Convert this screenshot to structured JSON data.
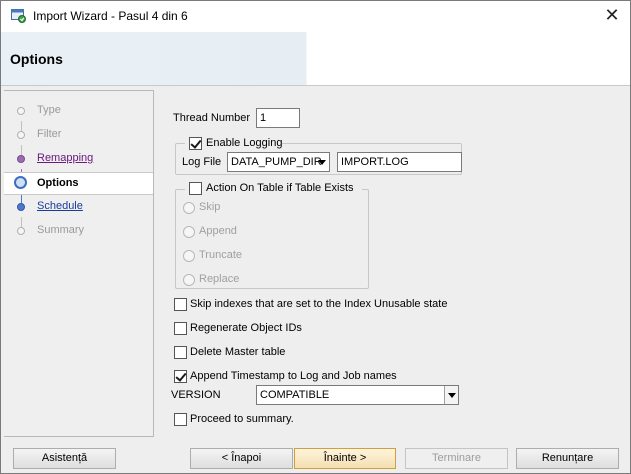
{
  "window": {
    "title": "Import Wizard - Pasul 4 din 6",
    "close_glyph": "✕"
  },
  "header": {
    "title": "Options"
  },
  "nav": {
    "items": [
      {
        "label": "Type",
        "state": "disabled"
      },
      {
        "label": "Filter",
        "state": "disabled"
      },
      {
        "label": "Remapping",
        "state": "visited"
      },
      {
        "label": "Options",
        "state": "active"
      },
      {
        "label": "Schedule",
        "state": "link"
      },
      {
        "label": "Summary",
        "state": "disabled"
      }
    ]
  },
  "options": {
    "thread_number_label": "Thread Number",
    "thread_number_value": "1",
    "enable_logging_label": "Enable Logging",
    "enable_logging_checked": true,
    "log_file_label": "Log File",
    "log_dir_value": "DATA_PUMP_DIR",
    "log_file_value": "IMPORT.LOG",
    "action_on_table_label": "Action On Table if Table Exists",
    "action_on_table_checked": false,
    "action_choices": [
      "Skip",
      "Append",
      "Truncate",
      "Replace"
    ],
    "skip_indexes_label": "Skip indexes that are set to the Index Unusable state",
    "skip_indexes_checked": false,
    "regenerate_ids_label": "Regenerate Object IDs",
    "regenerate_ids_checked": false,
    "delete_master_label": "Delete Master table",
    "delete_master_checked": false,
    "append_timestamp_label": "Append Timestamp to Log and Job names",
    "append_timestamp_checked": true,
    "version_label": "VERSION",
    "version_value": "COMPATIBLE",
    "proceed_summary_label": "Proceed to summary.",
    "proceed_summary_checked": false
  },
  "footer": {
    "help_label": "Asistență",
    "back_label": "< Înapoi",
    "next_label": "Înainte >",
    "finish_label": "Terminare",
    "cancel_label": "Renunțare"
  },
  "colors": {
    "accent": "#3c6ec2",
    "visited_link": "#6b1a80",
    "link": "#1b3d9a"
  }
}
